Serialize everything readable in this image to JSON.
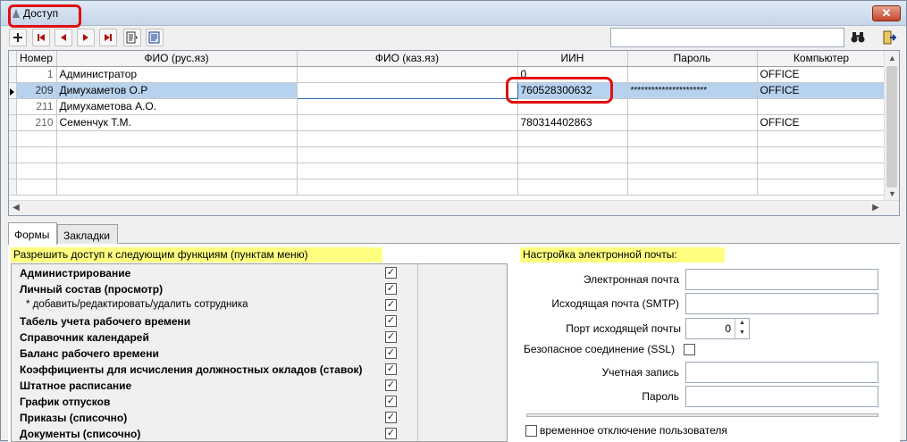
{
  "window": {
    "title": "Доступ",
    "close_glyph": "✕"
  },
  "toolbar": {
    "icons": [
      "add-icon",
      "first-record-icon",
      "prev-record-icon",
      "next-record-icon",
      "last-record-icon",
      "report-icon",
      "edit-icon"
    ],
    "search_value": "",
    "find_icon": "binoculars-icon",
    "exit_icon": "exit-door-icon"
  },
  "grid": {
    "columns": [
      "Номер",
      "ФИО (рус.яз)",
      "ФИО (каз.яз)",
      "ИИН",
      "Пароль",
      "Компьютер"
    ],
    "rows": [
      {
        "num": "1",
        "fio_ru": "Администратор",
        "fio_kz": "",
        "iin": "0",
        "password": "",
        "computer": "OFFICE"
      },
      {
        "num": "209",
        "fio_ru": "Димухаметов О.Р",
        "fio_kz": "",
        "iin": "760528300632",
        "password": "**********************",
        "computer": "OFFICE"
      },
      {
        "num": "211",
        "fio_ru": "Димухаметова А.О.",
        "fio_kz": "",
        "iin": "",
        "password": "",
        "computer": ""
      },
      {
        "num": "210",
        "fio_ru": "Семенчук Т.М.",
        "fio_kz": "",
        "iin": "780314402863",
        "password": "",
        "computer": "OFFICE"
      }
    ],
    "selected_row": 1
  },
  "tabs": [
    "Формы",
    "Закладки"
  ],
  "permissions": {
    "heading": "Разрешить доступ к следующим функциям (пунктам меню)",
    "items": [
      {
        "label": "Администрирование",
        "checked": true,
        "sub": false
      },
      {
        "label": "Личный состав (просмотр)",
        "checked": true,
        "sub": false
      },
      {
        "label": "* добавить/редактировать/удалить сотрудника",
        "checked": true,
        "sub": true
      },
      {
        "label": "Табель учета рабочего времени",
        "checked": true,
        "sub": false
      },
      {
        "label": "Справочник календарей",
        "checked": true,
        "sub": false
      },
      {
        "label": "Баланс рабочего времени",
        "checked": true,
        "sub": false
      },
      {
        "label": "Коэффициенты для исчисления должностных окладов (ставок)",
        "checked": true,
        "sub": false
      },
      {
        "label": "Штатное расписание",
        "checked": true,
        "sub": false
      },
      {
        "label": "График отпусков",
        "checked": true,
        "sub": false
      },
      {
        "label": "Приказы (списочно)",
        "checked": true,
        "sub": false
      },
      {
        "label": "Документы (списочно)",
        "checked": true,
        "sub": false
      }
    ]
  },
  "email": {
    "heading": "Настройка электронной почты:",
    "email_label": "Электронная почта",
    "email_value": "",
    "smtp_label": "Исходящая почта (SMTP)",
    "smtp_value": "",
    "port_label": "Порт исходящей почты",
    "port_value": "0",
    "ssl_label": "Безопасное соединение (SSL)",
    "account_label": "Учетная запись",
    "account_value": "",
    "password_label": "Пароль",
    "password_value": "",
    "disable_label": "временное отключение пользователя"
  }
}
